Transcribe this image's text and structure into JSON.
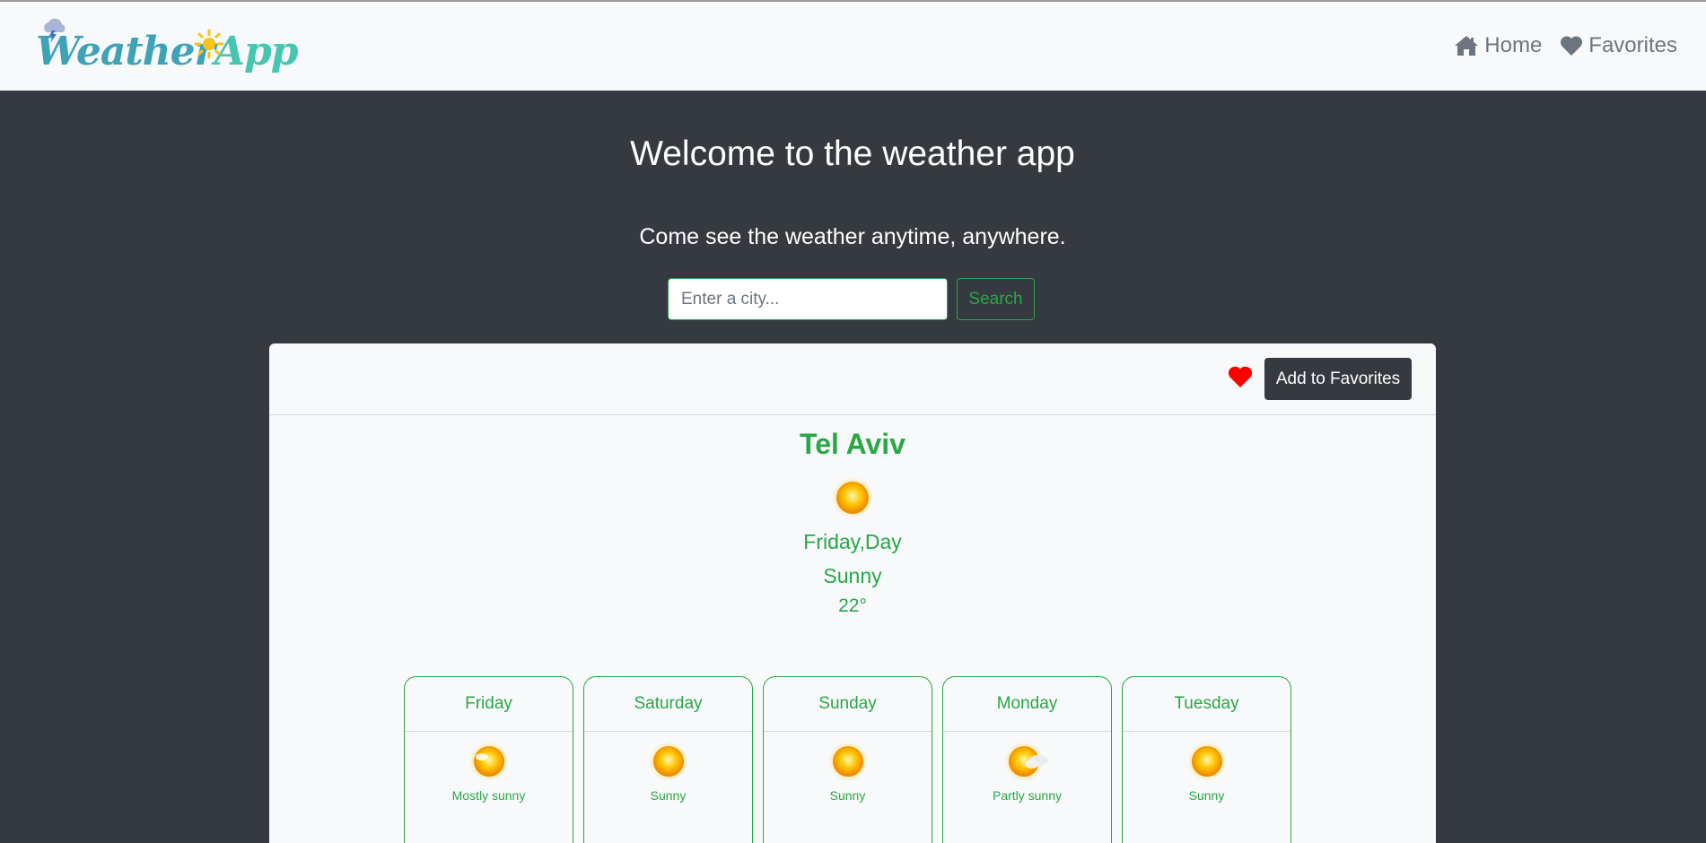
{
  "navbar": {
    "logo": {
      "part1": "Weather",
      "part2": "App"
    },
    "links": [
      {
        "label": "Home",
        "icon": "home-icon"
      },
      {
        "label": "Favorites",
        "icon": "heart-icon"
      }
    ]
  },
  "hero": {
    "title": "Welcome to the weather app",
    "subtitle": "Come see the weather anytime, anywhere."
  },
  "search": {
    "placeholder": "Enter a city...",
    "value": "",
    "button_label": "Search"
  },
  "current": {
    "favorite_button_label": "Add to Favorites",
    "favorite_icon": "heart-icon",
    "city": "Tel Aviv",
    "icon": "sun-icon",
    "day": "Friday,Day",
    "condition": "Sunny",
    "temperature": "22°"
  },
  "forecast": [
    {
      "day": "Friday",
      "condition": "Mostly sunny",
      "icon": "mostly-sunny-icon"
    },
    {
      "day": "Saturday",
      "condition": "Sunny",
      "icon": "sun-icon"
    },
    {
      "day": "Sunday",
      "condition": "Sunny",
      "icon": "sun-icon"
    },
    {
      "day": "Monday",
      "condition": "Partly sunny",
      "icon": "partly-sunny-icon"
    },
    {
      "day": "Tuesday",
      "condition": "Sunny",
      "icon": "sun-icon"
    }
  ],
  "colors": {
    "background": "#343a40",
    "navbar": "#f8f9fa",
    "accent": "#28a745",
    "heart": "#ff0000"
  }
}
